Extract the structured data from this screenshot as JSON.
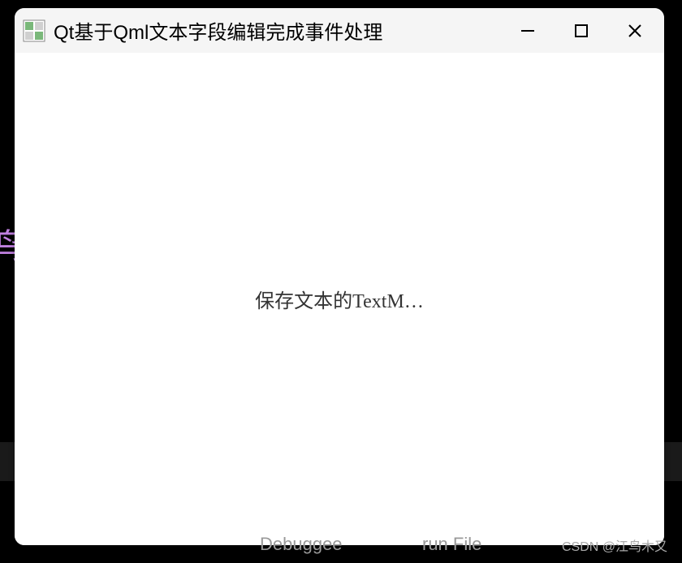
{
  "window": {
    "title": "Qt基于Qml文本字段编辑完成事件处理"
  },
  "content": {
    "center_text": "保存文本的TextM…"
  },
  "background": {
    "left_text": "鸟",
    "debuggee": "Debuggee",
    "runfile": "run File",
    "watermark": "CSDN @江鸟木又"
  }
}
